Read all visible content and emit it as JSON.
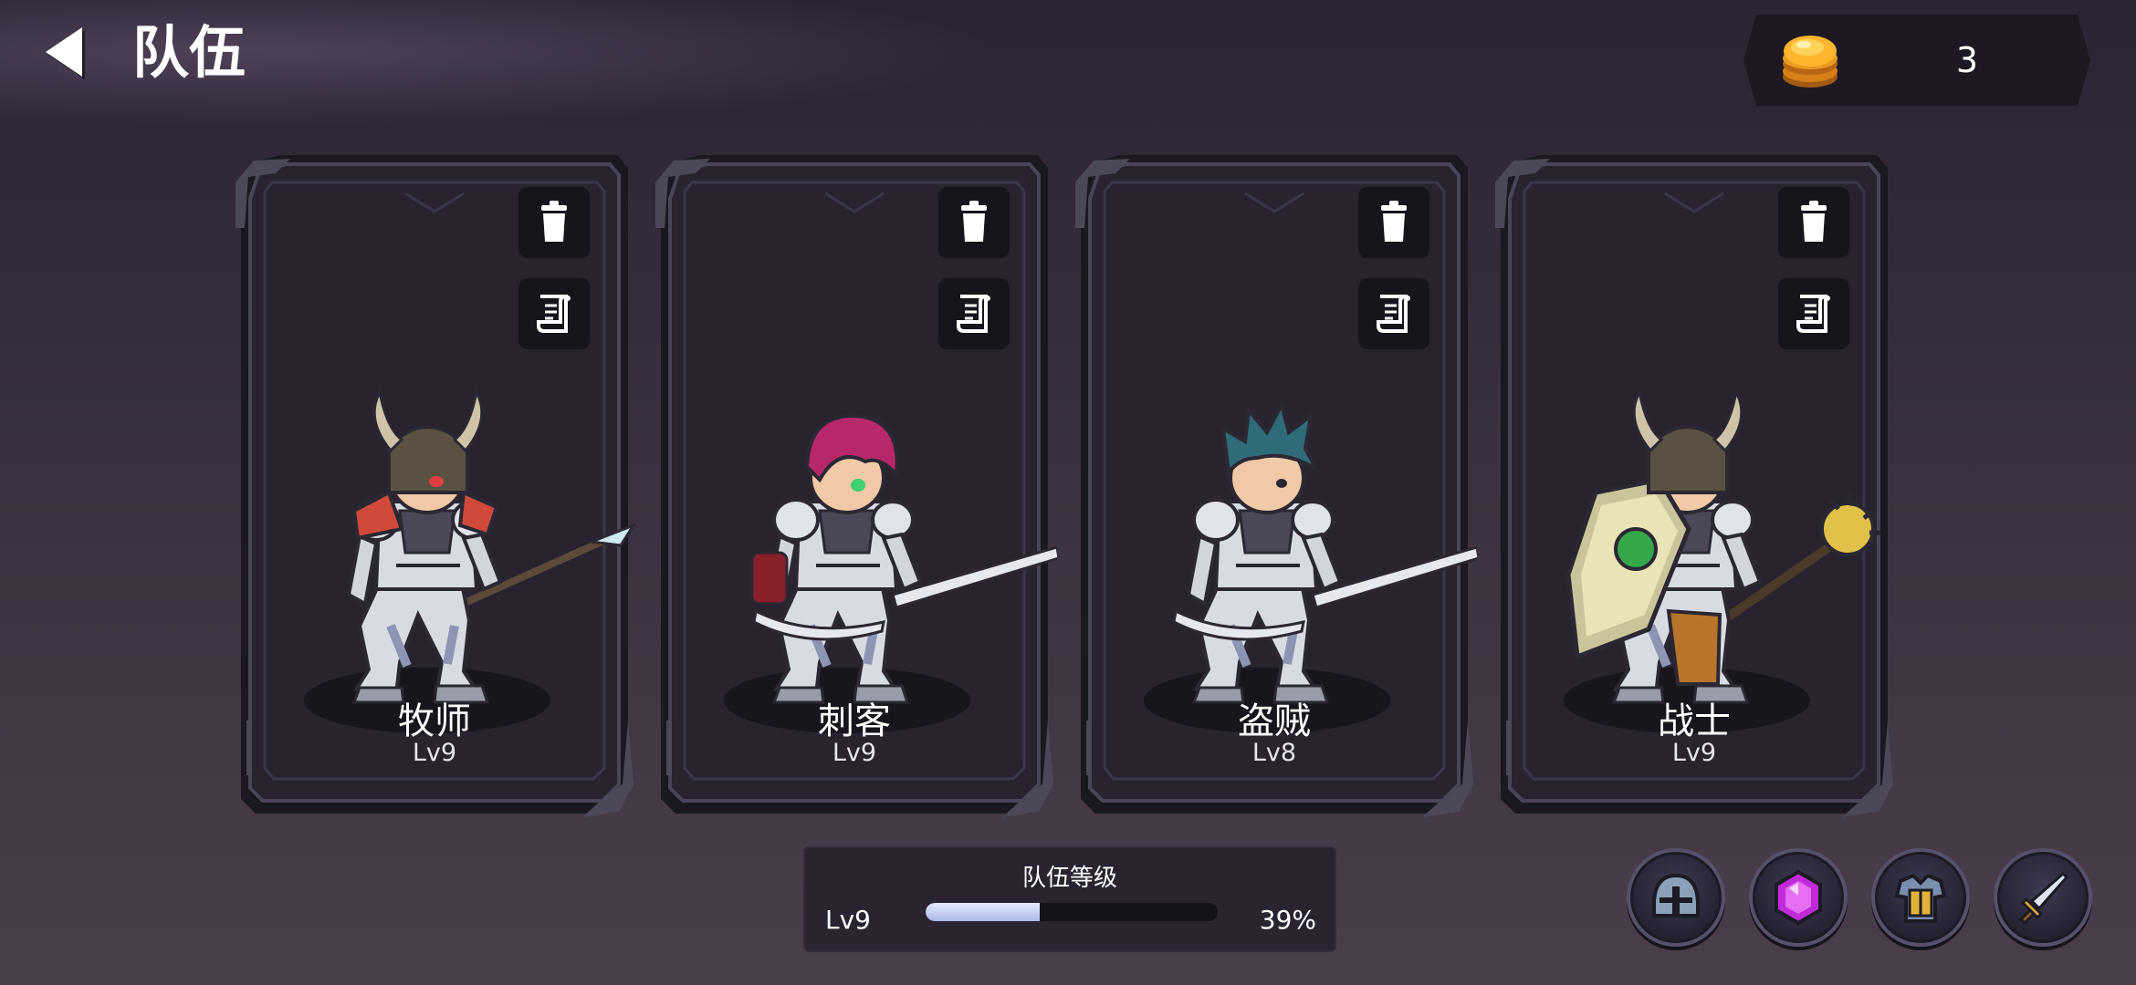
{
  "header": {
    "title": "队伍"
  },
  "currency": {
    "amount": "3",
    "icon": "gold-coin-icon"
  },
  "cards": [
    {
      "name": "牧师",
      "level": "Lv9"
    },
    {
      "name": "刺客",
      "level": "Lv9"
    },
    {
      "name": "盗贼",
      "level": "Lv8"
    },
    {
      "name": "战士",
      "level": "Lv9"
    }
  ],
  "team_level": {
    "title": "队伍等级",
    "level": "Lv9",
    "percent_text": "39%",
    "progress": 0.39
  },
  "bottom_buttons": [
    {
      "icon": "helmet-icon"
    },
    {
      "icon": "purple-gem-icon"
    },
    {
      "icon": "armor-icon"
    },
    {
      "icon": "sword-icon"
    }
  ],
  "colors": {
    "background": "#3a303f",
    "card": "#28232f",
    "xp_fill": "#c8d2f2"
  }
}
